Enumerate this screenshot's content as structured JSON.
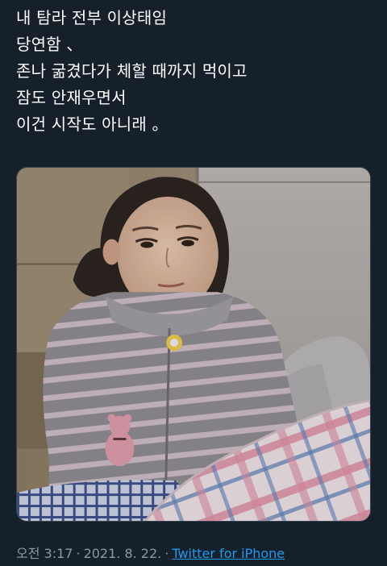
{
  "tweet": {
    "lines": [
      "내 탐라 전부 이상태임",
      "당연함 、",
      "존나 굶겼다가 체할 때까지 먹이고",
      "잠도 안재우면서",
      "이건 시작도 아니래 。"
    ],
    "time": "오전 3:17",
    "separator": "·",
    "date": "2021. 8. 22.",
    "source": "Twitter for iPhone"
  },
  "colors": {
    "background": "#15202b",
    "text": "#ffffff",
    "meta": "#8b98a5",
    "link": "#1d9bf0"
  }
}
